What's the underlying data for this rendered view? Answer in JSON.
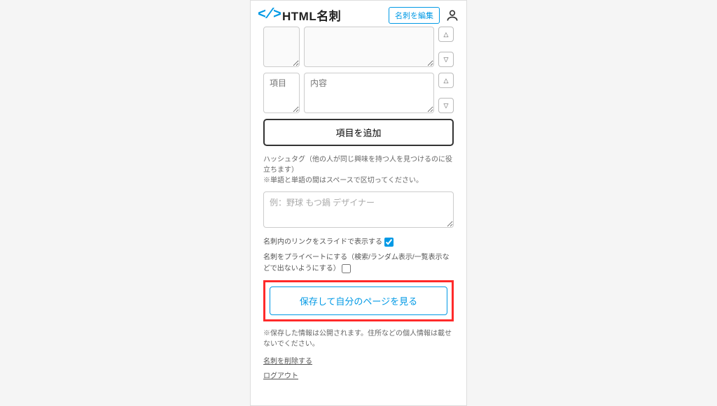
{
  "header": {
    "logo_code": "</>",
    "logo_text": "HTML名刺",
    "edit_button": "名刺を編集"
  },
  "item_rows": [
    {
      "label_placeholder": "",
      "value_placeholder": "",
      "blurred": true
    },
    {
      "label_placeholder": "項目",
      "value_placeholder": "内容",
      "blurred": false
    }
  ],
  "add_item_button": "項目を追加",
  "hashtag": {
    "help1": "ハッシュタグ（他の人が同じ興味を持つ人を見つけるのに役立ちます）",
    "help2": "※単語と単語の間はスペースで区切ってください。",
    "placeholder": "例：野球 もつ鍋 デザイナー"
  },
  "checks": {
    "slide_label": "名刺内のリンクをスライドで表示する",
    "slide_checked": true,
    "private_label": "名刺をプライベートにする（検索/ランダム表示/一覧表示などで出ないようにする）",
    "private_checked": false
  },
  "save_button": "保存して自分のページを見る",
  "save_warning": "※保存した情報は公開されます。住所などの個人情報は載せないでください。",
  "links": {
    "delete": "名刺を削除する",
    "logout": "ログアウト"
  }
}
